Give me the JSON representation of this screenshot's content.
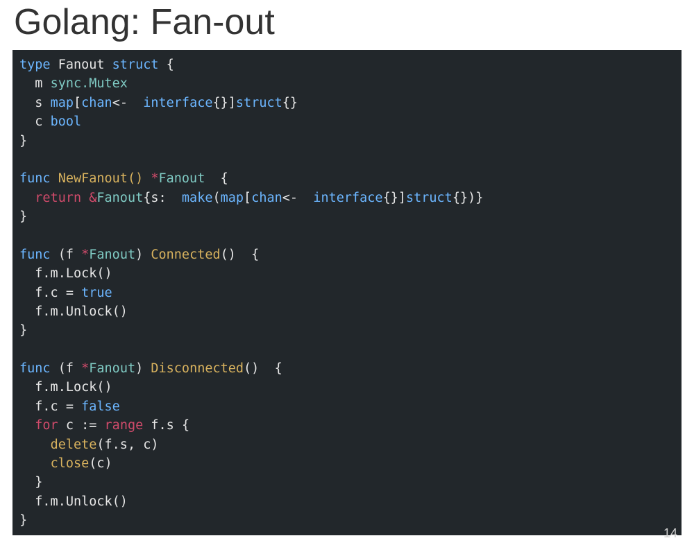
{
  "slide": {
    "title": "Golang: Fan-out",
    "page_number": "14",
    "code": {
      "l01_type": "type",
      "l01_name": " Fanout ",
      "l01_struct": "struct",
      "l01_brace": " {",
      "l02_indent": "  m ",
      "l02_sync": "sync.Mutex",
      "l03_indent": "  s ",
      "l03_map": "map",
      "l03_bracket_open": "[",
      "l03_chan": "chan",
      "l03_arrow": "<-",
      "l03_iface": "  interface",
      "l03_ifacebraces": "{}",
      "l03_bracket_close": "]",
      "l03_struct": "struct",
      "l03_structbraces": "{}",
      "l04_indent": "  c ",
      "l04_bool": "bool",
      "l05_brace": "}",
      "l07_func": "func",
      "l07_name": " NewFanout() ",
      "l07_star": "*",
      "l07_type": "Fanout",
      "l07_brace": "  {",
      "l08_indent": "  ",
      "l08_return": "return",
      "l08_sp": " ",
      "l08_amp": "&",
      "l08_fanout": "Fanout",
      "l08_open": "{s:  ",
      "l08_make": "make",
      "l08_paren_open": "(",
      "l08_map": "map",
      "l08_bracket_open": "[",
      "l08_chan": "chan",
      "l08_arrow": "<-",
      "l08_iface": "  interface",
      "l08_ifacebraces": "{}",
      "l08_bracket_close": "]",
      "l08_struct": "struct",
      "l08_structbraces": "{})}",
      "l09_brace": "}",
      "l11_func": "func",
      "l11_recv": " (f ",
      "l11_star": "*",
      "l11_type": "Fanout",
      "l11_close_recv": ") ",
      "l11_name": "Connected",
      "l11_parens": "()  {",
      "l12": "  f.m.Lock()",
      "l13_indent": "  f.c = ",
      "l13_true": "true",
      "l14": "  f.m.Unlock()",
      "l15_brace": "}",
      "l17_func": "func",
      "l17_recv": " (f ",
      "l17_star": "*",
      "l17_type": "Fanout",
      "l17_close_recv": ") ",
      "l17_name": "Disconnected",
      "l17_parens": "()  {",
      "l18": "  f.m.Lock()",
      "l19_indent": "  f.c = ",
      "l19_false": "false",
      "l20_indent": "  ",
      "l20_for": "for",
      "l20_c": " c ",
      "l20_assign": ":=",
      "l20_sp": " ",
      "l20_range": "range",
      "l20_fs": " f.s {",
      "l21_indent": "    ",
      "l21_delete": "delete",
      "l21_args": "(f.s, c)",
      "l22_indent": "    ",
      "l22_close": "close",
      "l22_args": "(c)",
      "l23": "  }",
      "l24": "  f.m.Unlock()",
      "l25_brace": "}"
    }
  }
}
